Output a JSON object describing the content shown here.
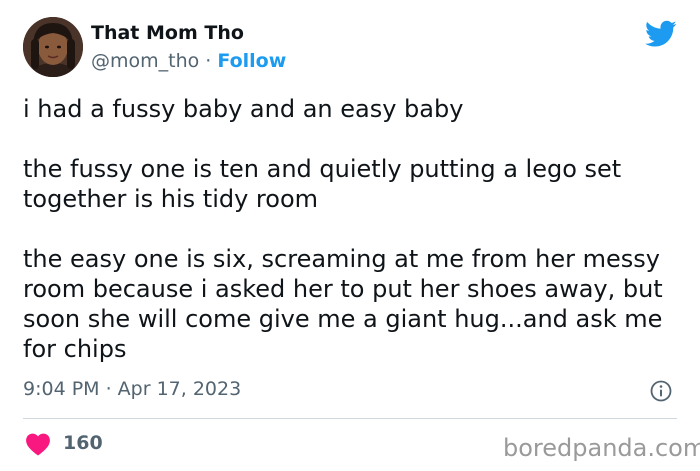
{
  "tweet": {
    "author": {
      "display_name": "That Mom Tho",
      "handle": "@mom_tho",
      "separator": " · ",
      "follow_label": "Follow"
    },
    "paragraphs": [
      "i had a fussy baby and an easy baby",
      "the fussy one is ten and quietly putting a lego set together is his tidy room",
      "the easy one is six, screaming at me from her messy room because i asked her to put her shoes away, but soon she will come give me a giant hug...and ask me for chips"
    ],
    "timestamp": "9:04 PM · Apr 17, 2023",
    "like_count": "160"
  },
  "watermark": "boredpanda.com",
  "colors": {
    "twitter_blue": "#1d9bf0",
    "heart_red": "#f91880",
    "secondary_text": "#536471"
  },
  "icons": {
    "platform": "twitter-bird-icon",
    "info": "info-icon",
    "like": "heart-icon"
  }
}
